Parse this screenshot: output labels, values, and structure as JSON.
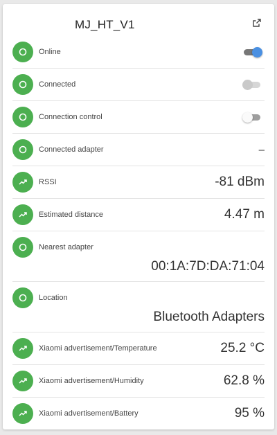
{
  "entity": {
    "title": "MJ_HT_V1"
  },
  "rows": {
    "online": {
      "label": "Online",
      "icon": "circle-outline-icon",
      "state": "on"
    },
    "connected": {
      "label": "Connected",
      "icon": "circle-outline-icon",
      "state": "disabled"
    },
    "connection_control": {
      "label": "Connection control",
      "icon": "circle-outline-icon",
      "state": "off"
    },
    "connected_adapter": {
      "label": "Connected adapter",
      "icon": "circle-outline-icon",
      "value": "–"
    },
    "rssi": {
      "label": "RSSI",
      "icon": "trending-up-icon",
      "value": "-81 dBm"
    },
    "estimated_distance": {
      "label": "Estimated distance",
      "icon": "trending-up-icon",
      "value": "4.47 m"
    },
    "nearest_adapter": {
      "label": "Nearest adapter",
      "icon": "circle-outline-icon",
      "value": "00:1A:7D:DA:71:04"
    },
    "location": {
      "label": "Location",
      "icon": "circle-outline-icon",
      "value": "Bluetooth Adapters"
    },
    "temperature": {
      "label": "Xiaomi advertisement/Temperature",
      "icon": "trending-up-icon",
      "value": "25.2 °C"
    },
    "humidity": {
      "label": "Xiaomi advertisement/Humidity",
      "icon": "trending-up-icon",
      "value": "62.8 %"
    },
    "battery": {
      "label": "Xiaomi advertisement/Battery",
      "icon": "trending-up-icon",
      "value": "95 %"
    }
  },
  "colors": {
    "icon_badge": "#4caf50",
    "toggle_on_thumb": "#4a90e2"
  }
}
